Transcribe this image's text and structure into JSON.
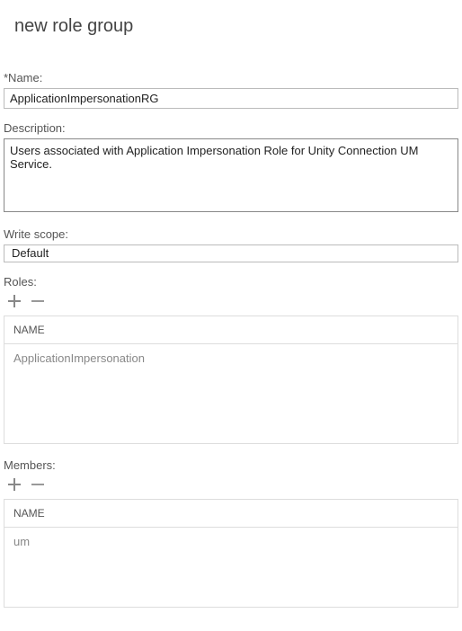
{
  "page_title": "new role group",
  "name": {
    "label": "*Name:",
    "value": "ApplicationImpersonationRG"
  },
  "description": {
    "label": "Description:",
    "value": "Users associated with Application Impersonation Role for Unity Connection UM Service."
  },
  "write_scope": {
    "label": "Write scope:",
    "value": "Default"
  },
  "roles": {
    "label": "Roles:",
    "column_header": "NAME",
    "items": [
      {
        "name": "ApplicationImpersonation"
      }
    ]
  },
  "members": {
    "label": "Members:",
    "column_header": "NAME",
    "items": [
      {
        "name": "um"
      }
    ]
  }
}
